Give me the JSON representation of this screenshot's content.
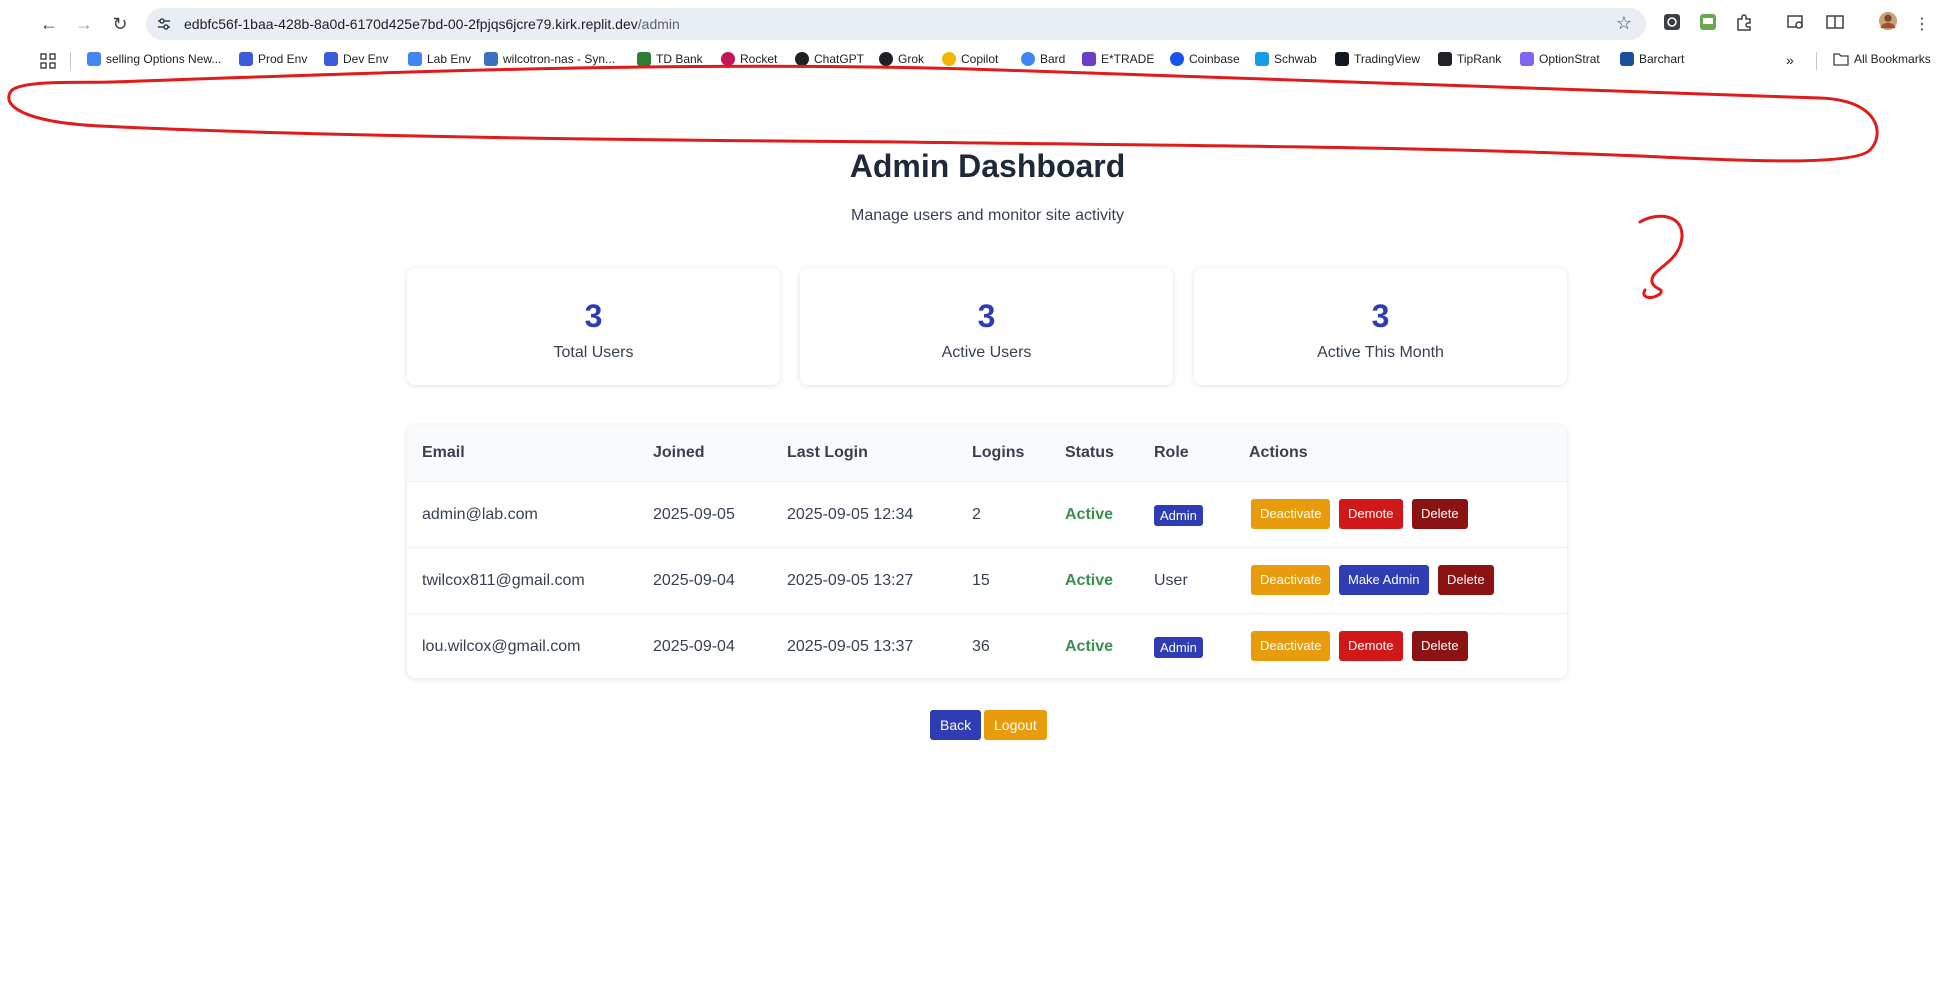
{
  "browser": {
    "url_host": "edbfc56f-1baa-428b-8a0d-6170d425e7bd-00-2fpjqs6jcre79.kirk.replit.dev",
    "url_path": "/admin",
    "bookmarks": [
      {
        "label": "selling Options New...",
        "color": "#4285f4"
      },
      {
        "label": "Prod Env",
        "color": "#3b5bdb"
      },
      {
        "label": "Dev Env",
        "color": "#3b5bdb"
      },
      {
        "label": "Lab Env",
        "color": "#4285f4"
      },
      {
        "label": "wilcotron-nas - Syn...",
        "color": "#3a6fc4"
      },
      {
        "label": "TD Bank",
        "color": "#2e7d32"
      },
      {
        "label": "Rocket",
        "color": "#c2185b"
      },
      {
        "label": "ChatGPT",
        "color": "#202124"
      },
      {
        "label": "Grok",
        "color": "#202124"
      },
      {
        "label": "Copilot",
        "color": "#f4b400"
      },
      {
        "label": "Bard",
        "color": "#4285f4"
      },
      {
        "label": "E*TRADE",
        "color": "#6a3fc8"
      },
      {
        "label": "Coinbase",
        "color": "#1652f0"
      },
      {
        "label": "Schwab",
        "color": "#1a9be8"
      },
      {
        "label": "TradingView",
        "color": "#131722"
      },
      {
        "label": "TipRank",
        "color": "#202124"
      },
      {
        "label": "OptionStrat",
        "color": "#7b68ee"
      },
      {
        "label": "Barchart",
        "color": "#1a4fa0"
      }
    ],
    "all_bookmarks": "All Bookmarks"
  },
  "header": {
    "title": "Admin Dashboard",
    "subtitle": "Manage users and monitor site activity"
  },
  "stats": [
    {
      "value": "3",
      "label": "Total Users"
    },
    {
      "value": "3",
      "label": "Active Users"
    },
    {
      "value": "3",
      "label": "Active This Month"
    }
  ],
  "table": {
    "columns": [
      "Email",
      "Joined",
      "Last Login",
      "Logins",
      "Status",
      "Role",
      "Actions"
    ],
    "rows": [
      {
        "email": "admin@lab.com",
        "joined": "2025-09-05",
        "last_login": "2025-09-05 12:34",
        "logins": "2",
        "status": "Active",
        "role": "Admin",
        "actions": [
          "Deactivate",
          "Demote",
          "Delete"
        ]
      },
      {
        "email": "twilcox811@gmail.com",
        "joined": "2025-09-04",
        "last_login": "2025-09-05 13:27",
        "logins": "15",
        "status": "Active",
        "role": "User",
        "actions": [
          "Deactivate",
          "Make Admin",
          "Delete"
        ]
      },
      {
        "email": "lou.wilcox@gmail.com",
        "joined": "2025-09-04",
        "last_login": "2025-09-05 13:37",
        "logins": "36",
        "status": "Active",
        "role": "Admin",
        "actions": [
          "Deactivate",
          "Demote",
          "Delete"
        ]
      }
    ]
  },
  "footer": {
    "back": "Back",
    "logout": "Logout"
  },
  "colors": {
    "accent": "#2f3db5",
    "warning": "#e89c0b",
    "danger": "#d01818",
    "danger_dark": "#8b1313",
    "success": "#3a8f4f",
    "annotation": "#e01b1b"
  }
}
